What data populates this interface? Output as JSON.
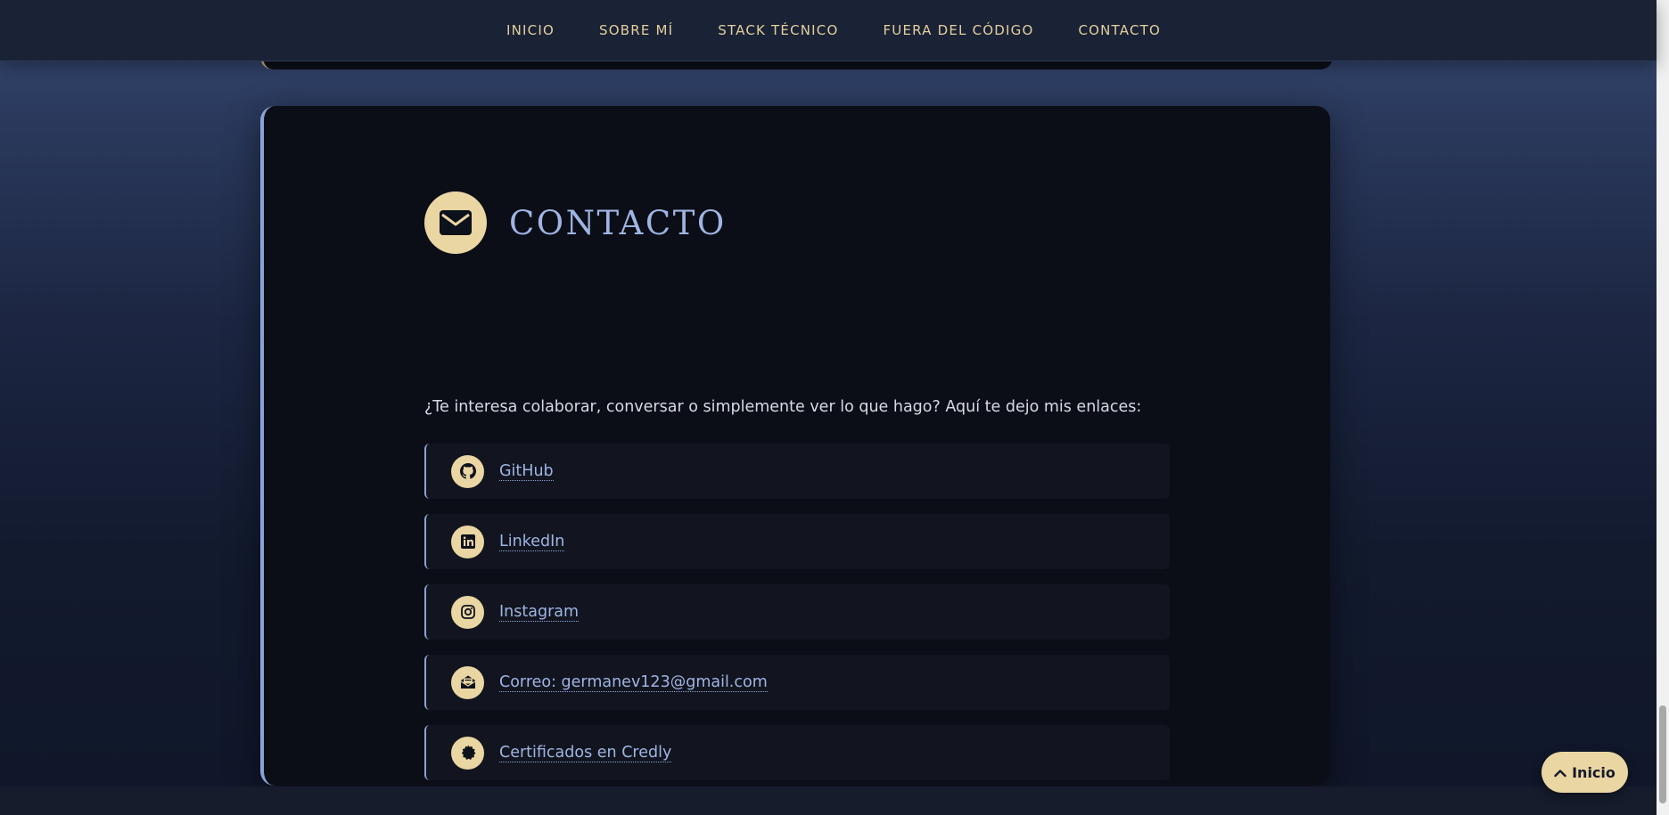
{
  "nav": {
    "items": [
      {
        "label": "INICIO"
      },
      {
        "label": "SOBRE MÍ"
      },
      {
        "label": "STACK TÉCNICO"
      },
      {
        "label": "FUERA DEL CÓDIGO"
      },
      {
        "label": "CONTACTO"
      }
    ]
  },
  "contact": {
    "title": "CONTACTO",
    "header_icon": "envelope-icon",
    "intro": "¿Te interesa colaborar, conversar o simplemente ver lo que hago? Aquí te dejo mis enlaces:",
    "links": [
      {
        "label": "GitHub",
        "icon": "github-icon"
      },
      {
        "label": "LinkedIn",
        "icon": "linkedin-icon"
      },
      {
        "label": "Instagram",
        "icon": "instagram-icon"
      },
      {
        "label": "Correo: germanev123@gmail.com",
        "icon": "envelope-open-icon"
      },
      {
        "label": "Certificados en Credly",
        "icon": "certificate-icon"
      }
    ]
  },
  "back_to_top": {
    "label": "Inicio",
    "icon": "chevron-up-icon"
  },
  "colors": {
    "accent_gold": "#ead6a3",
    "accent_blue": "#9fb4e2",
    "card_bg": "#0b0e17",
    "nav_bg": "#1a2236"
  }
}
